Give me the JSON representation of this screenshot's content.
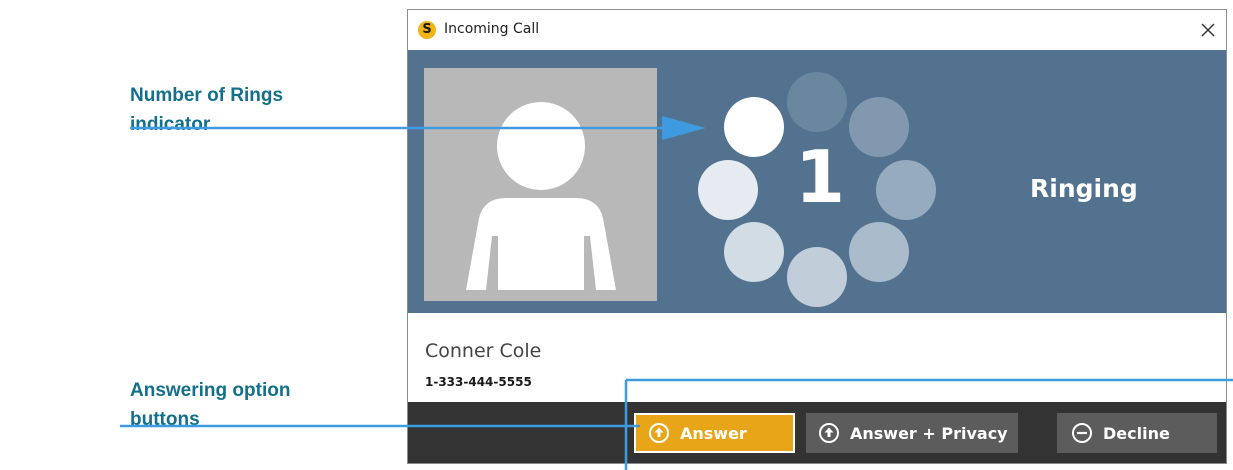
{
  "annotations": {
    "rings_callout": [
      "Number of Rings",
      "indicator"
    ],
    "buttons_callout": [
      "Answering option",
      "buttons"
    ]
  },
  "window": {
    "title": "Incoming Call",
    "app_icon": "sorenson-s-logo",
    "close_icon": "close-icon"
  },
  "call": {
    "ring_count": "1",
    "status": "Ringing",
    "caller_name": "Conner Cole",
    "caller_number": "1-333-444-5555",
    "ring_dots_total": 8,
    "ring_dots_active": 1
  },
  "buttons": {
    "answer": "Answer",
    "answer_privacy": "Answer + Privacy",
    "decline": "Decline"
  },
  "colors": {
    "banner": "#53728f",
    "answer": "#e8a517",
    "secondary_button": "#5c5c5c",
    "action_bar": "#333333",
    "callout_text": "#136f8a",
    "callout_line": "#3f9be0"
  }
}
